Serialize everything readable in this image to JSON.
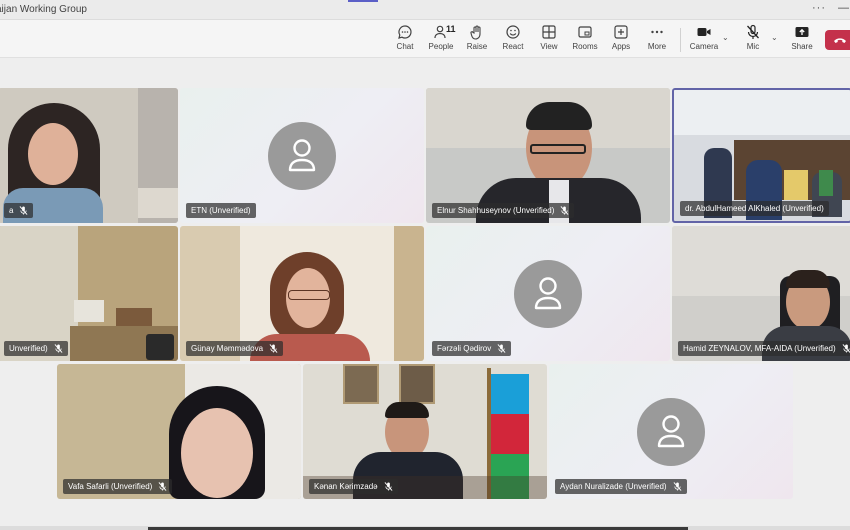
{
  "window": {
    "title": "aijan Working Group",
    "more_label": "···",
    "minimize_label": "—"
  },
  "toolbar": {
    "chat": "Chat",
    "people": "People",
    "people_count": "11",
    "raise": "Raise",
    "react": "React",
    "view": "View",
    "rooms": "Rooms",
    "apps": "Apps",
    "more": "More",
    "camera": "Camera",
    "mic": "Mic",
    "share": "Share",
    "caret": "⌄"
  },
  "participants": [
    {
      "name": "a",
      "video": true
    },
    {
      "name": "ETN (Unverified)",
      "video": false
    },
    {
      "name": "Elnur Shahhuseynov (Unverified)",
      "video": true
    },
    {
      "name": "dr. AbdulHameed AlKhaled (Unverified)",
      "video": true,
      "active": true
    },
    {
      "name": "Unverified)",
      "video": true
    },
    {
      "name": "Günay Məmmədova",
      "video": true
    },
    {
      "name": "Fərzəli Qədirov",
      "video": false
    },
    {
      "name": "Hamid ZEYNALOV, MFA-AIDA (Unverified)",
      "video": true
    },
    {
      "name": "Vafa Safarli (Unverified)",
      "video": true
    },
    {
      "name": "Kənan Kərimzadə",
      "video": true
    },
    {
      "name": "Aydan Nuralizade (Unverified)",
      "video": false
    }
  ],
  "colors": {
    "accent": "#5b5fc7",
    "leave": "#c4314b",
    "avatar": "#9a9a9a"
  }
}
